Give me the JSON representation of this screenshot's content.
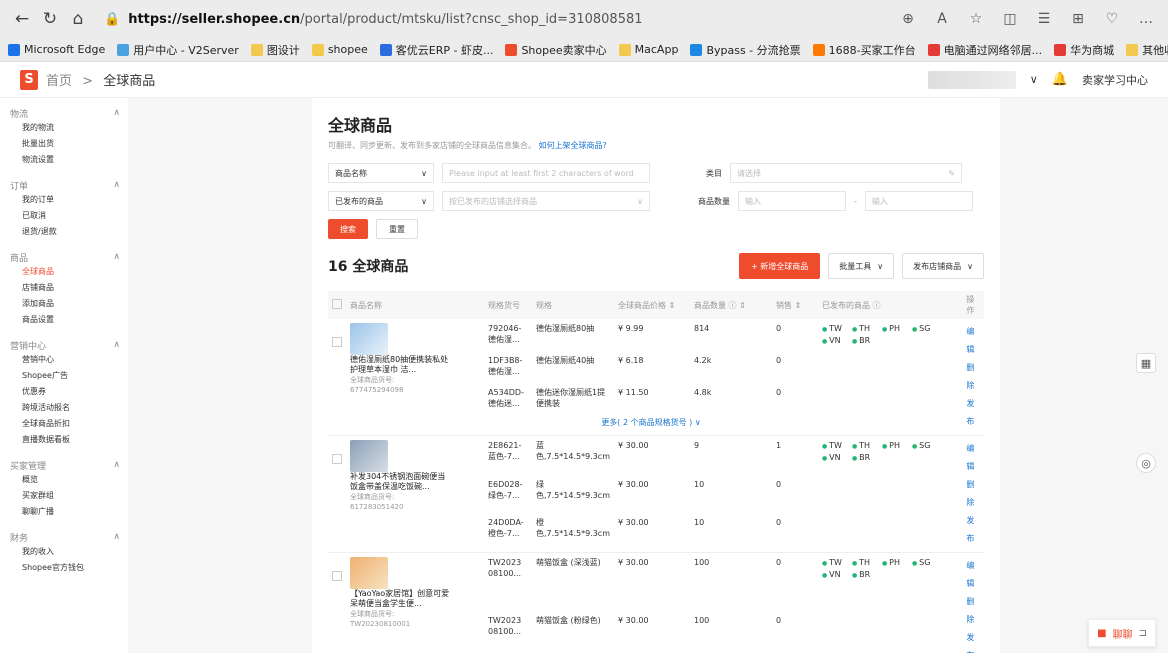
{
  "browser": {
    "url_host": "https://seller.shopee.cn",
    "url_path": "/portal/product/mtsku/list?cnsc_shop_id=310808581"
  },
  "bookmarks": [
    "Microsoft Edge",
    "用户中心 - V2Server",
    "图设计",
    "shopee",
    "客优云ERP - 虾皮...",
    "Shopee卖家中心",
    "MacApp",
    "Bypass - 分流抢票",
    "1688-买家工作台",
    "电脑通过网络邻居...",
    "华为商城"
  ],
  "bookmarks_right": "其他收藏夹",
  "shopbar": {
    "crumb_home": "首页",
    "crumb_sep": ">",
    "crumb_current": "全球商品",
    "learn": "卖家学习中心"
  },
  "sidebar": [
    {
      "title": "物流",
      "items": [
        "我的物流",
        "批量出货",
        "物流设置"
      ]
    },
    {
      "title": "订单",
      "items": [
        "我的订单",
        "已取消",
        "退货/退款"
      ]
    },
    {
      "title": "商品",
      "items": [
        "全球商品",
        "店铺商品",
        "添加商品",
        "商品设置"
      ]
    },
    {
      "title": "营销中心",
      "items": [
        "营销中心",
        "Shopee广告",
        "优惠券",
        "跨境活动报名",
        "全球商品折扣",
        "直播数据看板"
      ]
    },
    {
      "title": "买家管理",
      "items": [
        "概览",
        "买家群组",
        "聊聊广播"
      ]
    },
    {
      "title": "财务",
      "items": [
        "我的收入",
        "Shopee官方钱包"
      ]
    }
  ],
  "page": {
    "title": "全球商品",
    "subtitle": "可翻译、同步更新、发布到多家店铺的全球商品信息集合。",
    "subtitle_link": "如何上架全球商品?",
    "filter1_select": "商品名称",
    "filter1_placeholder": "Please input at least first 2 characters of word",
    "category_label": "类目",
    "category_placeholder": "请选择",
    "filter2_select": "已发布的商品",
    "filter2_placeholder": "按已发布的店铺选择商品",
    "qty_label": "商品数量",
    "qty_min": "输入",
    "qty_max": "输入",
    "search": "搜索",
    "reset": "重置",
    "count": "16 全球商品",
    "add": "+ 新增全球商品",
    "bulk": "批量工具",
    "publish": "发布店铺商品"
  },
  "table": {
    "headers": [
      "商品名称",
      "规格货号",
      "规格",
      "全球商品价格 ⇕",
      "商品数量 ⓘ ⇕",
      "销售 ⇕",
      "已发布的商品 ⓘ",
      "操作"
    ],
    "products": [
      {
        "name": "德佑湿厕纸80抽便携装私处护理草本湿巾 洁...",
        "id": "全球商品货号: 677475294098",
        "variants": [
          {
            "sku": "792046-德佑湿...",
            "spec": "德佑湿厕纸80抽",
            "price": "¥ 9.99",
            "qty": "814",
            "sales": "0"
          },
          {
            "sku": "1DF3B8-德佑湿...",
            "spec": "德佑湿厕纸40抽",
            "price": "¥ 6.18",
            "qty": "4.2k",
            "sales": "0"
          },
          {
            "sku": "A534DD-德佑迷...",
            "spec": "德佑迷你湿厕纸1提便携装",
            "price": "¥ 11.50",
            "qty": "4.8k",
            "sales": "0"
          }
        ],
        "more": "更多( 2 个商品规格货号 ) ∨",
        "sites": [
          "TW",
          "TH",
          "PH",
          "SG",
          "VN",
          "BR"
        ],
        "actions": [
          "编辑",
          "删除",
          "发布"
        ]
      },
      {
        "name": "补发304不锈钢泡面碗便当饭盒带盖保温吃饭碗...",
        "id": "全球商品货号: 617283051420",
        "variants": [
          {
            "sku": "2E8621-蓝色-7...",
            "spec": "蓝色,7.5*14.5*9.3cm",
            "price": "¥ 30.00",
            "qty": "9",
            "sales": "1"
          },
          {
            "sku": "E6D028-绿色-7...",
            "spec": "绿色,7.5*14.5*9.3cm",
            "price": "¥ 30.00",
            "qty": "10",
            "sales": "0"
          },
          {
            "sku": "24D0DA-橙色-7...",
            "spec": "橙色,7.5*14.5*9.3cm",
            "price": "¥ 30.00",
            "qty": "10",
            "sales": "0"
          }
        ],
        "sites": [
          "TW",
          "TH",
          "PH",
          "SG",
          "VN",
          "BR"
        ],
        "actions": [
          "编辑",
          "删除",
          "发布"
        ]
      },
      {
        "name": "【YaoYao家居馆】创意可爱呆萌便当盒学生便...",
        "id": "全球商品货号: TW20230810001",
        "variants": [
          {
            "sku": "TW2023 08100...",
            "spec": "萌猫饭盒 (深浅蓝)",
            "price": "¥ 30.00",
            "qty": "100",
            "sales": "0"
          },
          {
            "sku": "TW2023 08100...",
            "spec": "萌猫饭盒 (粉绿色)",
            "price": "¥ 30.00",
            "qty": "100",
            "sales": "0"
          }
        ],
        "sites": [
          "TW",
          "TH",
          "PH",
          "SG",
          "VN",
          "BR"
        ],
        "actions": [
          "编辑",
          "删除",
          "发布"
        ]
      }
    ]
  },
  "chat": "聊聊",
  "colors": {
    "accent": "#ee4d2d",
    "link": "#1976d2",
    "site_dot": "#21b573"
  }
}
